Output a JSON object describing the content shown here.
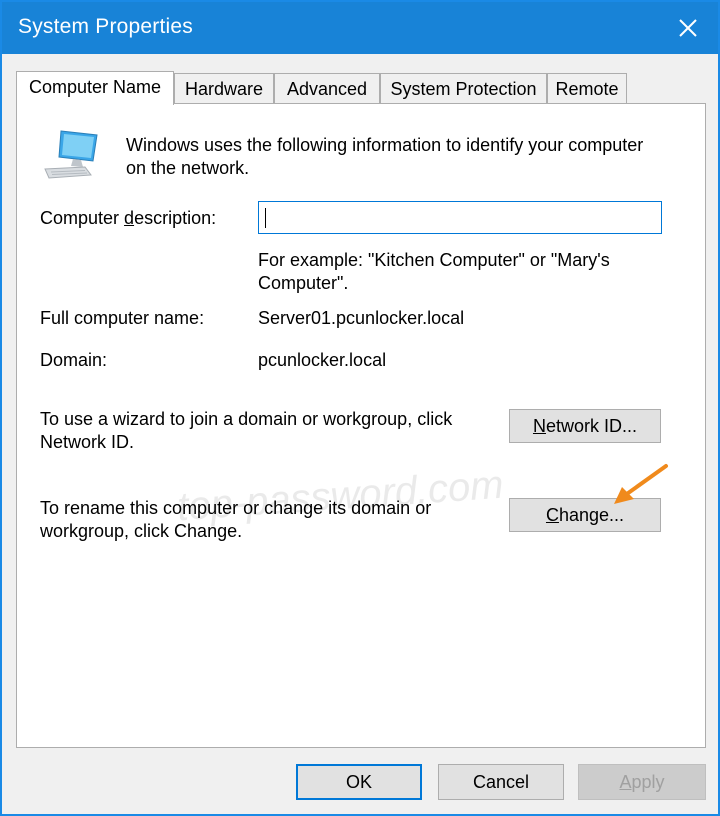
{
  "window": {
    "title": "System Properties"
  },
  "tabs": [
    "Computer Name",
    "Hardware",
    "Advanced",
    "System Protection",
    "Remote"
  ],
  "intro": {
    "line1": "Windows uses the following information to identify your computer",
    "line2": "on the network."
  },
  "description": {
    "label_pre": "Computer ",
    "label_u": "d",
    "label_post": "escription:",
    "value": "",
    "hint_line1": "For example: \"Kitchen Computer\" or \"Mary's",
    "hint_line2": "Computer\"."
  },
  "full_name": {
    "label": "Full computer name:",
    "value": "Server01.pcunlocker.local"
  },
  "domain": {
    "label": "Domain:",
    "value": "pcunlocker.local"
  },
  "network_id": {
    "text_line1": "To use a wizard to join a domain or workgroup, click",
    "text_line2": "Network ID.",
    "button_u": "N",
    "button_rest": "etwork ID..."
  },
  "rename": {
    "text_line1": "To rename this computer or change its domain or",
    "text_line2": "workgroup, click Change.",
    "button_u": "C",
    "button_rest": "hange..."
  },
  "watermark": "top-password.com",
  "footer": {
    "ok": "OK",
    "cancel": "Cancel",
    "apply_u": "A",
    "apply_rest": "pply"
  },
  "icons": [
    "computer-icon",
    "close-icon",
    "orange-arrow-icon"
  ],
  "colors": {
    "titlebar": "#1883d7",
    "accent": "#0078d7",
    "arrow": "#f08a1c"
  }
}
